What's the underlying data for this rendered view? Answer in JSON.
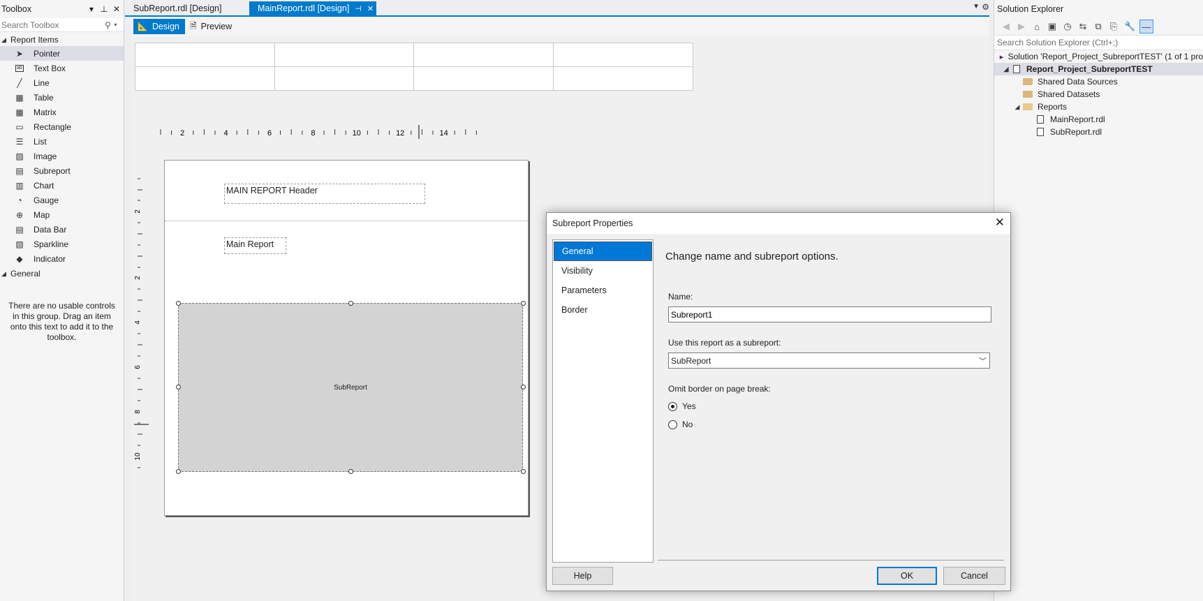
{
  "toolbox": {
    "title": "Toolbox",
    "search_placeholder": "Search Toolbox",
    "group_report_items": "Report Items",
    "items": [
      {
        "label": "Pointer",
        "icon": "pointer-icon"
      },
      {
        "label": "Text Box",
        "icon": "textbox-icon"
      },
      {
        "label": "Line",
        "icon": "line-icon"
      },
      {
        "label": "Table",
        "icon": "table-icon"
      },
      {
        "label": "Matrix",
        "icon": "matrix-icon"
      },
      {
        "label": "Rectangle",
        "icon": "rectangle-icon"
      },
      {
        "label": "List",
        "icon": "list-icon"
      },
      {
        "label": "Image",
        "icon": "image-icon"
      },
      {
        "label": "Subreport",
        "icon": "subreport-icon"
      },
      {
        "label": "Chart",
        "icon": "chart-icon"
      },
      {
        "label": "Gauge",
        "icon": "gauge-icon"
      },
      {
        "label": "Map",
        "icon": "map-icon"
      },
      {
        "label": "Data Bar",
        "icon": "databar-icon"
      },
      {
        "label": "Sparkline",
        "icon": "sparkline-icon"
      },
      {
        "label": "Indicator",
        "icon": "indicator-icon"
      }
    ],
    "group_general": "General",
    "empty_note": "There are no usable controls in this group. Drag an item onto this text to add it to the toolbox."
  },
  "tabs": {
    "inactive": "SubReport.rdl [Design]",
    "active": "MainReport.rdl [Design]"
  },
  "view": {
    "design": "Design",
    "preview": "Preview"
  },
  "ruler": {
    "h_labels": [
      "2",
      "4",
      "6",
      "8",
      "10",
      "12",
      "14"
    ],
    "v_labels": [
      "2",
      "2",
      "4",
      "6",
      "8",
      "10"
    ]
  },
  "report": {
    "header_text": "MAIN REPORT Header",
    "body_text": "Main Report",
    "subreport_label": "SubReport"
  },
  "solution_explorer": {
    "title": "Solution Explorer",
    "search_placeholder": "Search Solution Explorer (Ctrl+;)",
    "solution": "Solution 'Report_Project_SubreportTEST' (1 of 1 pro",
    "project": "Report_Project_SubreportTEST",
    "shared_data_sources": "Shared Data Sources",
    "shared_datasets": "Shared Datasets",
    "reports": "Reports",
    "files": [
      "MainReport.rdl",
      "SubReport.rdl"
    ]
  },
  "dialog": {
    "title": "Subreport Properties",
    "nav": [
      "General",
      "Visibility",
      "Parameters",
      "Border"
    ],
    "heading": "Change name and subreport options.",
    "name_label": "Name:",
    "name_value": "Subreport1",
    "use_report_label": "Use this report as a subreport:",
    "use_report_value": "SubReport",
    "omit_border_label": "Omit border on page break:",
    "radio_yes": "Yes",
    "radio_no": "No",
    "help": "Help",
    "ok": "OK",
    "cancel": "Cancel"
  },
  "colors": {
    "accent": "#007acc",
    "selection": "#0078d7",
    "subreport_fill": "#d3d3d3"
  }
}
